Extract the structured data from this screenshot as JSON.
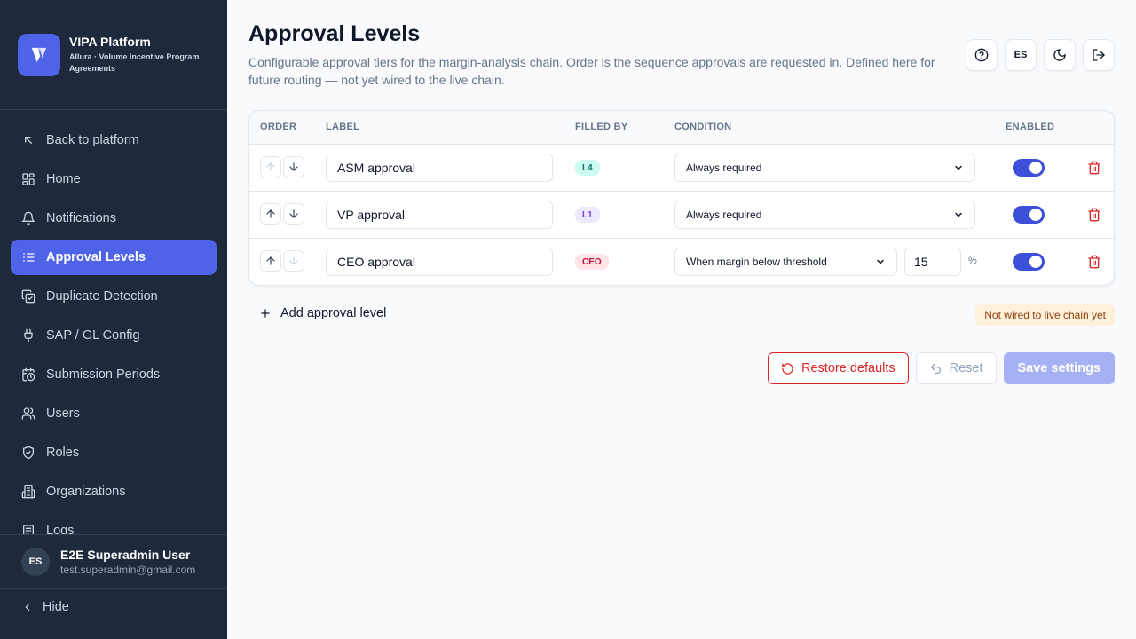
{
  "brand": {
    "title": "VIPA Platform",
    "subtitle": "Allura · Volume Incentive Program Agreements",
    "accent": "#4f63e8"
  },
  "sidebar": {
    "items": [
      {
        "label": "Back to platform",
        "icon": "back-arrow-icon",
        "active": false
      },
      {
        "label": "Home",
        "icon": "grid-icon",
        "active": false
      },
      {
        "label": "Notifications",
        "icon": "bell-icon",
        "active": false
      },
      {
        "label": "Approval Levels",
        "icon": "list-icon",
        "active": true
      },
      {
        "label": "Duplicate Detection",
        "icon": "copy-check-icon",
        "active": false
      },
      {
        "label": "SAP / GL Config",
        "icon": "plug-icon",
        "active": false
      },
      {
        "label": "Submission Periods",
        "icon": "calendar-clock-icon",
        "active": false
      },
      {
        "label": "Users",
        "icon": "users-icon",
        "active": false
      },
      {
        "label": "Roles",
        "icon": "shield-icon",
        "active": false
      },
      {
        "label": "Organizations",
        "icon": "building-icon",
        "active": false
      },
      {
        "label": "Logs",
        "icon": "log-icon",
        "active": false
      }
    ],
    "user": {
      "initials": "ES",
      "name": "E2E Superadmin User",
      "email": "test.superadmin@gmail.com"
    },
    "hide_label": "Hide"
  },
  "header": {
    "title": "Approval Levels",
    "description": "Configurable approval tiers for the margin-analysis chain. Order is the sequence approvals are requested in. Defined here for future routing — not yet wired to the live chain.",
    "lang_label": "ES"
  },
  "table": {
    "columns": {
      "order": "ORDER",
      "label": "LABEL",
      "filled_by": "FILLED BY",
      "condition": "CONDITION",
      "enabled": "ENABLED"
    },
    "rows": [
      {
        "label": "ASM approval",
        "filled_by": "L4",
        "condition": "Always required",
        "enabled": true
      },
      {
        "label": "VP approval",
        "filled_by": "L1",
        "condition": "Always required",
        "enabled": true
      },
      {
        "label": "CEO approval",
        "filled_by": "CEO",
        "condition": "When margin below threshold",
        "threshold": "15",
        "unit": "%",
        "enabled": true
      }
    ]
  },
  "actions": {
    "add_level": "Add approval level",
    "notice": "Not wired to live chain yet",
    "restore": "Restore defaults",
    "reset": "Reset",
    "save": "Save settings"
  }
}
